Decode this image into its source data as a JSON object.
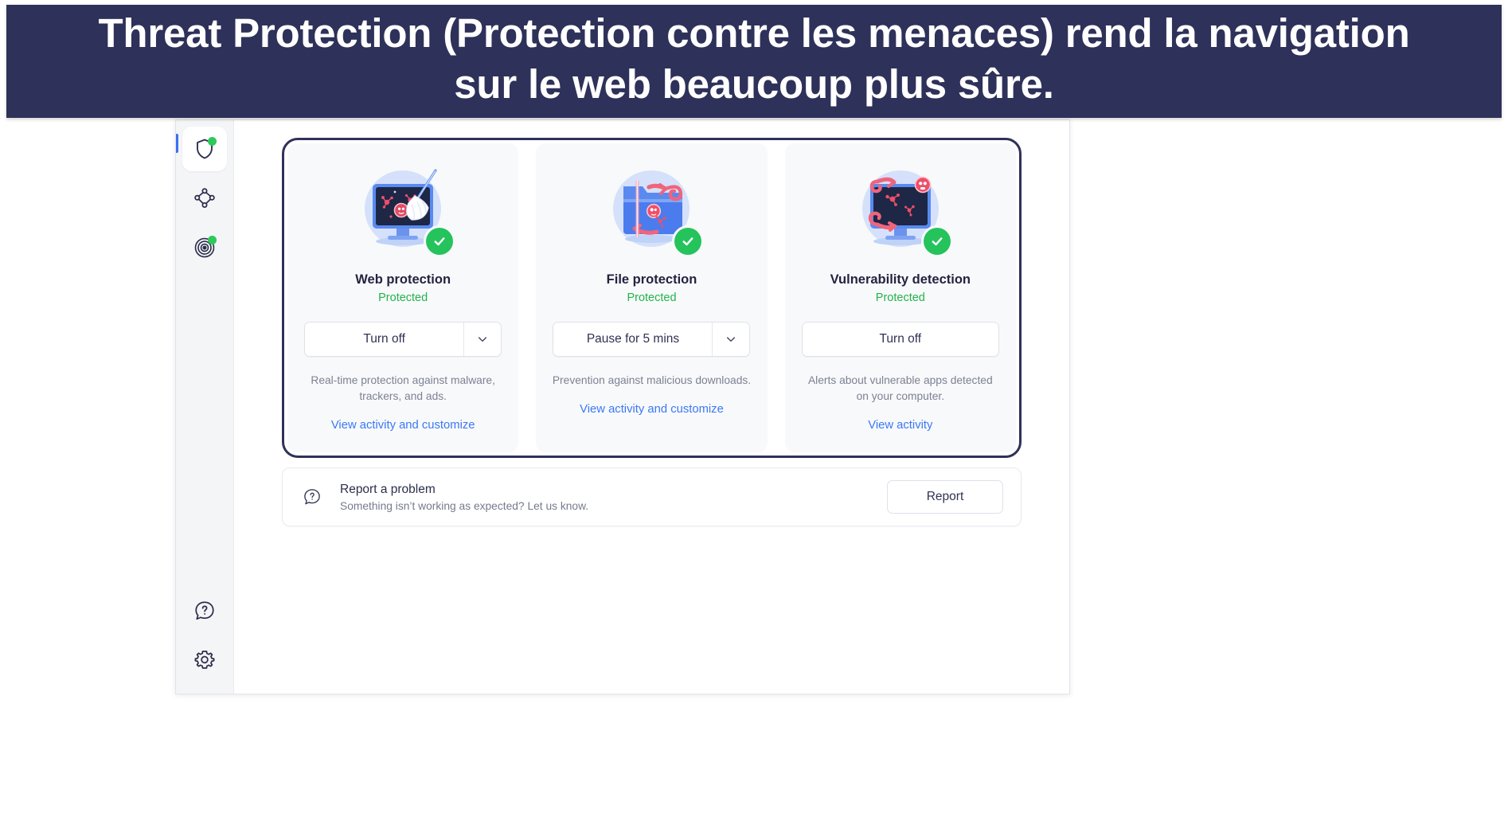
{
  "banner": {
    "text": "Threat Protection (Protection contre les menaces) rend la navigation sur le web beaucoup plus sûre.",
    "background_color": "#2e3159",
    "text_color": "#ffffff"
  },
  "sidebar": {
    "items": [
      {
        "name": "threat-protection",
        "icon": "shield-icon",
        "active": true,
        "status_dot": "green"
      },
      {
        "name": "mesh-network",
        "icon": "mesh-network-icon",
        "active": false,
        "status_dot": "none"
      },
      {
        "name": "dark-web-monitor",
        "icon": "radar-target-icon",
        "active": false,
        "status_dot": "green"
      }
    ],
    "bottom_items": [
      {
        "name": "help",
        "icon": "help-bubble-icon"
      },
      {
        "name": "settings",
        "icon": "gear-icon"
      }
    ],
    "active_indicator_color": "#3b6ef0",
    "status_dot_color": "#2ec85b"
  },
  "highlight": {
    "border_color": "#2e3159"
  },
  "cards": [
    {
      "id": "web-protection",
      "illustration": "monitor-broom-malware-icon",
      "title": "Web protection",
      "status": "Protected",
      "status_color": "#23b34b",
      "action_label": "Turn off",
      "has_dropdown": true,
      "description": "Real-time protection against malware, trackers, and ads.",
      "link_label": "View activity and customize",
      "link_color": "#3b78f5",
      "badge": "check-badge-icon"
    },
    {
      "id": "file-protection",
      "illustration": "folder-scan-malware-icon",
      "title": "File protection",
      "status": "Protected",
      "status_color": "#23b34b",
      "action_label": "Pause for 5 mins",
      "has_dropdown": true,
      "description": "Prevention against malicious downloads.",
      "link_label": "View activity and customize",
      "link_color": "#3b78f5",
      "badge": "check-badge-icon"
    },
    {
      "id": "vulnerability-detection",
      "illustration": "monitor-vulnerability-icon",
      "title": "Vulnerability detection",
      "status": "Protected",
      "status_color": "#23b34b",
      "action_label": "Turn off",
      "has_dropdown": false,
      "description": "Alerts about vulnerable apps detected on your computer.",
      "link_label": "View activity",
      "link_color": "#3b78f5",
      "badge": "check-badge-icon"
    }
  ],
  "report": {
    "icon": "question-bubble-icon",
    "title": "Report a problem",
    "subtitle": "Something isn’t working as expected? Let us know.",
    "button_label": "Report"
  }
}
